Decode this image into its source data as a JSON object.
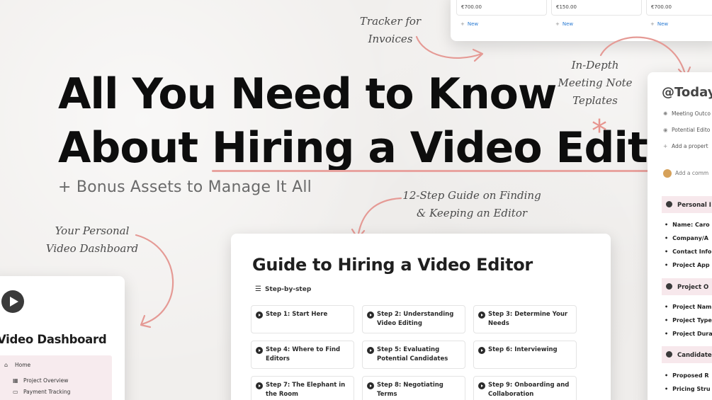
{
  "headline": {
    "line1": "All You Need to Know",
    "line2_prefix": "About ",
    "line2_highlight": "Hiring a Video Editor",
    "asterisk": "*"
  },
  "subheadline": "+ Bonus Assets to Manage It All",
  "annotations": {
    "invoices": [
      "Tracker for",
      "Invoices"
    ],
    "meeting": [
      "In-Depth",
      "Meeting Note",
      "Teplates"
    ],
    "guide": [
      "12-Step Guide on Finding",
      "& Keeping an Editor"
    ],
    "dashboard": [
      "Your Personal",
      "Video Dashboard"
    ]
  },
  "invoice_tracker": {
    "columns": [
      {
        "amount": "€700.00",
        "new_label": "New"
      },
      {
        "amount": "€150.00",
        "new_label": "New"
      },
      {
        "amount": "€700.00",
        "new_label": "New"
      }
    ]
  },
  "guide": {
    "title": "Guide to Hiring a Video Editor",
    "subtitle": "Step-by-step",
    "steps": [
      "Step 1: Start Here",
      "Step 2: Understanding Video Editing",
      "Step 3: Determine Your Needs",
      "Step 4: Where to Find Editors",
      "Step 5: Evaluating Potential Candidates",
      "Step 6: Interviewing",
      "Step 7: The Elephant in the Room",
      "Step 8: Negotiating Terms",
      "Step 9: Onboarding and Collaboration"
    ]
  },
  "dashboard": {
    "title": "Video Dashboard",
    "menu": [
      {
        "label": "Home",
        "icon": "home-icon"
      },
      {
        "label": "Project Overview",
        "icon": "grid-icon"
      },
      {
        "label": "Payment Tracking",
        "icon": "card-icon"
      }
    ]
  },
  "meeting": {
    "title": "@Today",
    "properties": [
      "Meeting Outco",
      "Potential Edito",
      "Add a propert"
    ],
    "comment_placeholder": "Add a comm",
    "sections": [
      {
        "title": "Personal I",
        "bullets": [
          "Name: Caro",
          "Company/A",
          "Contact Info",
          "Project App"
        ]
      },
      {
        "title": "Project O",
        "bullets": [
          "Project Nam",
          "Project Type",
          "Project Dura"
        ]
      },
      {
        "title": "Candidate",
        "bullets": [
          "Proposed R",
          "Pricing Stru"
        ]
      }
    ]
  },
  "colors": {
    "background": "#f1efed",
    "accent_pink": "#e8a39f",
    "arrow": "#e59a95",
    "section_pink": "#f7e8ec"
  }
}
